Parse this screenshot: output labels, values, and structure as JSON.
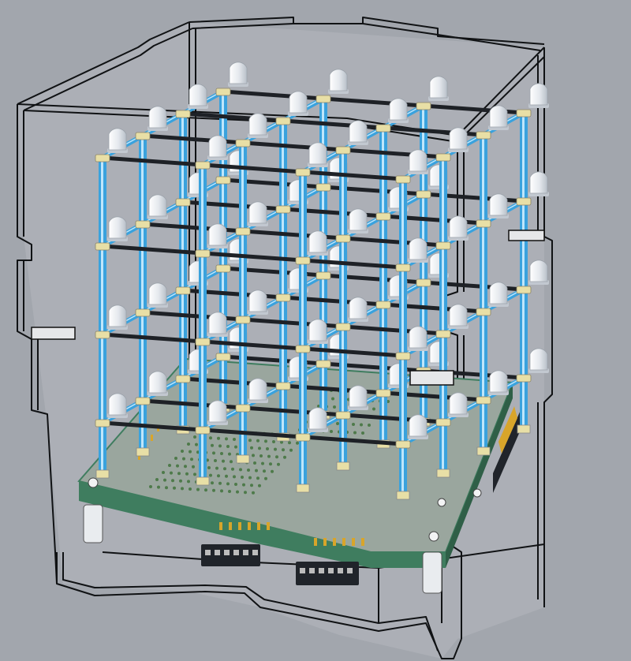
{
  "scene": {
    "subject": "led-cube-4x4x4",
    "grid": {
      "columns": 4,
      "rows": 4,
      "layers": 4
    },
    "enclosure": "transparent-acrylic-box"
  },
  "colors": {
    "background": "#a2a6ad",
    "enclosure_fill": "#c4c8ce",
    "enclosure_stroke": "#101214",
    "pillar": "#3aa2dd",
    "pillar_highlight": "#bfe6fb",
    "led_body": "#eef1f5",
    "led_shade": "#c2c8d0",
    "connector": "#e8dfa6",
    "rod": "#1e2126",
    "pcb": "#9aa69e",
    "pcb_edge": "#3f7d5f",
    "pcb_dots": "#4e7a4a",
    "pin_gold": "#d8a52a",
    "header_black": "#20242a"
  },
  "icons": [
    "led-icon",
    "standoff-icon",
    "header-connector-icon"
  ]
}
